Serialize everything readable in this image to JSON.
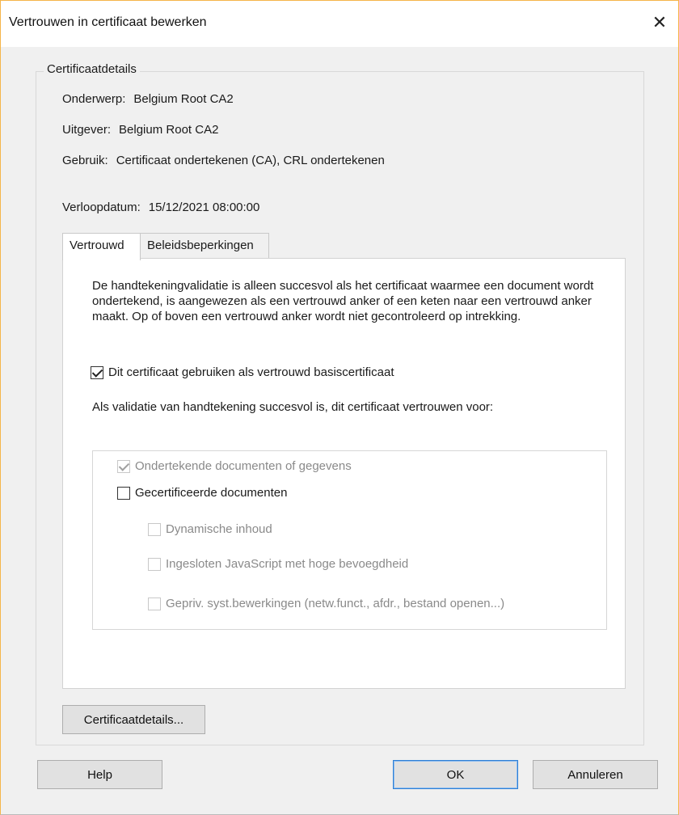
{
  "window": {
    "title": "Vertrouwen in certificaat bewerken",
    "close_glyph": "✕"
  },
  "details": {
    "group_label": "Certificaatdetails",
    "subject_label": "Onderwerp:",
    "subject_value": "Belgium Root CA2",
    "issuer_label": "Uitgever:",
    "issuer_value": "Belgium Root CA2",
    "usage_label": "Gebruik:",
    "usage_value": "Certificaat ondertekenen (CA), CRL ondertekenen",
    "expiry_label": "Verloopdatum:",
    "expiry_value": "15/12/2021 08:00:00"
  },
  "tabs": [
    {
      "label": "Vertrouwd",
      "active": true
    },
    {
      "label": "Beleidsbeperkingen",
      "active": false
    }
  ],
  "trusted": {
    "description": "De handtekeningvalidatie is alleen succesvol als het certificaat waarmee een document wordt ondertekend, is aangewezen als een vertrouwd anker of een keten naar een vertrouwd anker maakt. Op of boven een vertrouwd anker wordt niet gecontroleerd op intrekking.",
    "root_checkbox": {
      "label": "Dit certificaat gebruiken als vertrouwd basiscertificaat",
      "checked": true
    },
    "trust_for_label": "Als validatie van handtekening succesvol is, dit certificaat vertrouwen voor:",
    "options": {
      "signed_docs": {
        "label": "Ondertekende documenten of gegevens",
        "checked": true,
        "enabled": false
      },
      "certified_docs": {
        "label": "Gecertificeerde documenten",
        "checked": false,
        "enabled": true
      },
      "dynamic_content": {
        "label": "Dynamische inhoud",
        "checked": false,
        "enabled": false
      },
      "embedded_js": {
        "label": "Ingesloten JavaScript met hoge bevoegdheid",
        "checked": false,
        "enabled": false
      },
      "privileged_ops": {
        "label": "Gepriv. syst.bewerkingen (netw.funct., afdr., bestand openen...)",
        "checked": false,
        "enabled": false
      }
    }
  },
  "buttons": {
    "certificate_details": "Certificaatdetails...",
    "help": "Help",
    "ok": "OK",
    "cancel": "Annuleren"
  }
}
